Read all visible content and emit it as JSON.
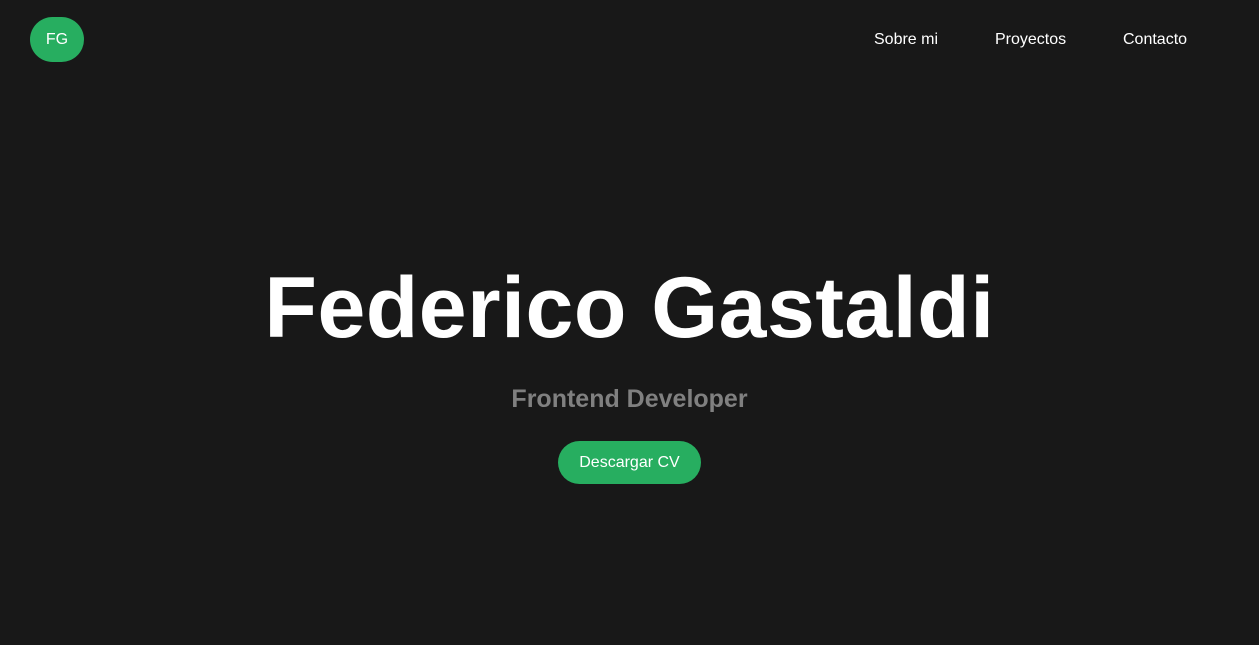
{
  "header": {
    "logo_text": "FG",
    "nav": [
      {
        "label": "Sobre mi"
      },
      {
        "label": "Proyectos"
      },
      {
        "label": "Contacto"
      }
    ]
  },
  "hero": {
    "name": "Federico Gastaldi",
    "role": "Frontend Developer",
    "cta_label": "Descargar CV"
  },
  "colors": {
    "background": "#181818",
    "accent": "#27ae60",
    "text": "#ffffff",
    "muted": "#808080"
  }
}
